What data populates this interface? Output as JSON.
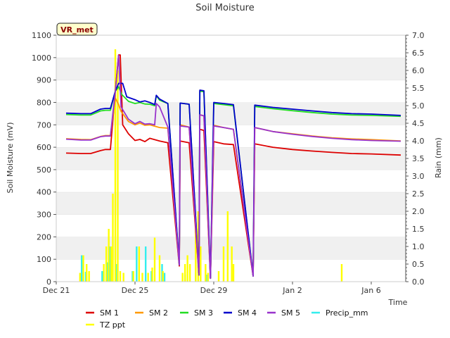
{
  "chart_data": {
    "type": "line",
    "title": "Soil Moisture",
    "xlabel": "Time",
    "ylabel": "Soil Moisture (mV)",
    "y2label": "Rain (mm)",
    "station_label": "VR_met",
    "xlim": [
      "2023-12-21",
      "2024-01-07 18:00"
    ],
    "x_ticks": [
      {
        "date": "2023-12-21",
        "label": "Dec 21"
      },
      {
        "date": "2023-12-25",
        "label": "Dec 25"
      },
      {
        "date": "2023-12-29",
        "label": "Dec 29"
      },
      {
        "date": "2024-01-02",
        "label": "Jan 2"
      },
      {
        "date": "2024-01-06",
        "label": "Jan 6"
      }
    ],
    "ylim": [
      0,
      1100
    ],
    "y_ticks": [
      0,
      100,
      200,
      300,
      400,
      500,
      600,
      700,
      800,
      900,
      1000,
      1100
    ],
    "y2lim": [
      0,
      7.0
    ],
    "y2_ticks": [
      "0.0",
      "0.5",
      "1.0",
      "1.5",
      "2.0",
      "2.5",
      "3.0",
      "3.5",
      "4.0",
      "4.5",
      "5.0",
      "5.5",
      "6.0",
      "6.5",
      "7.0"
    ],
    "grid": "horizontal bands",
    "legend_position": "bottom",
    "soil_series": [
      {
        "name": "SM 1",
        "color": "#dd0000",
        "points": [
          [
            "2023-12-21 12:00",
            574
          ],
          [
            "2023-12-22 06:00",
            572
          ],
          [
            "2023-12-22 18:00",
            572
          ],
          [
            "2023-12-23 06:00",
            585
          ],
          [
            "2023-12-23 12:00",
            590
          ],
          [
            "2023-12-23 18:00",
            590
          ],
          [
            "2023-12-24 00:00",
            850
          ],
          [
            "2023-12-24 04:00",
            1012
          ],
          [
            "2023-12-24 06:00",
            1012
          ],
          [
            "2023-12-24 09:00",
            700
          ],
          [
            "2023-12-24 16:00",
            660
          ],
          [
            "2023-12-25 00:00",
            630
          ],
          [
            "2023-12-25 06:00",
            635
          ],
          [
            "2023-12-25 12:00",
            625
          ],
          [
            "2023-12-25 18:00",
            640
          ],
          [
            "2023-12-26 06:00",
            628
          ],
          [
            "2023-12-26 16:00",
            620
          ],
          [
            "2023-12-27 06:00",
            70
          ],
          [
            "2023-12-27 07:00",
            628
          ],
          [
            "2023-12-27 18:00",
            620
          ],
          [
            "2023-12-28 06:00",
            30
          ],
          [
            "2023-12-28 07:00",
            680
          ],
          [
            "2023-12-28 12:00",
            675
          ],
          [
            "2023-12-28 20:00",
            15
          ],
          [
            "2023-12-29 00:00",
            625
          ],
          [
            "2023-12-29 12:00",
            615
          ],
          [
            "2023-12-30 00:00",
            612
          ],
          [
            "2023-12-31 00:00",
            25
          ],
          [
            "2023-12-31 02:00",
            615
          ],
          [
            "2024-01-01 00:00",
            600
          ],
          [
            "2024-01-02 00:00",
            590
          ],
          [
            "2024-01-03 00:00",
            583
          ],
          [
            "2024-01-04 00:00",
            577
          ],
          [
            "2024-01-05 00:00",
            572
          ],
          [
            "2024-01-06 00:00",
            570
          ],
          [
            "2024-01-07 12:00",
            565
          ]
        ]
      },
      {
        "name": "SM 2",
        "color": "#ff9900",
        "points": [
          [
            "2023-12-21 12:00",
            638
          ],
          [
            "2023-12-22 06:00",
            635
          ],
          [
            "2023-12-22 18:00",
            634
          ],
          [
            "2023-12-23 06:00",
            648
          ],
          [
            "2023-12-23 12:00",
            652
          ],
          [
            "2023-12-23 18:00",
            652
          ],
          [
            "2023-12-24 00:00",
            820
          ],
          [
            "2023-12-24 04:00",
            790
          ],
          [
            "2023-12-24 07:00",
            760
          ],
          [
            "2023-12-24 16:00",
            715
          ],
          [
            "2023-12-25 00:00",
            700
          ],
          [
            "2023-12-25 06:00",
            708
          ],
          [
            "2023-12-25 12:00",
            698
          ],
          [
            "2023-12-25 18:00",
            700
          ],
          [
            "2023-12-26 06:00",
            688
          ],
          [
            "2023-12-26 16:00",
            685
          ],
          [
            "2023-12-27 06:00",
            75
          ],
          [
            "2023-12-27 07:00",
            700
          ],
          [
            "2023-12-27 18:00",
            690
          ],
          [
            "2023-12-28 06:00",
            30
          ],
          [
            "2023-12-28 07:00",
            745
          ],
          [
            "2023-12-28 12:00",
            740
          ],
          [
            "2023-12-28 20:00",
            15
          ],
          [
            "2023-12-29 00:00",
            698
          ],
          [
            "2023-12-29 12:00",
            688
          ],
          [
            "2023-12-30 00:00",
            680
          ],
          [
            "2023-12-31 00:00",
            25
          ],
          [
            "2023-12-31 02:00",
            688
          ],
          [
            "2024-01-01 00:00",
            670
          ],
          [
            "2024-01-02 00:00",
            660
          ],
          [
            "2024-01-03 00:00",
            650
          ],
          [
            "2024-01-04 00:00",
            642
          ],
          [
            "2024-01-05 00:00",
            637
          ],
          [
            "2024-01-06 00:00",
            634
          ],
          [
            "2024-01-07 12:00",
            628
          ]
        ]
      },
      {
        "name": "SM 3",
        "color": "#22dd22",
        "points": [
          [
            "2023-12-21 12:00",
            746
          ],
          [
            "2023-12-22 06:00",
            744
          ],
          [
            "2023-12-22 18:00",
            744
          ],
          [
            "2023-12-23 06:00",
            762
          ],
          [
            "2023-12-23 12:00",
            765
          ],
          [
            "2023-12-23 18:00",
            765
          ],
          [
            "2023-12-24 00:00",
            850
          ],
          [
            "2023-12-24 04:00",
            870
          ],
          [
            "2023-12-24 08:00",
            835
          ],
          [
            "2023-12-24 16:00",
            805
          ],
          [
            "2023-12-25 00:00",
            795
          ],
          [
            "2023-12-25 06:00",
            800
          ],
          [
            "2023-12-25 12:00",
            793
          ],
          [
            "2023-12-25 18:00",
            792
          ],
          [
            "2023-12-26 00:00",
            785
          ],
          [
            "2023-12-26 02:00",
            830
          ],
          [
            "2023-12-26 06:00",
            810
          ],
          [
            "2023-12-26 16:00",
            795
          ],
          [
            "2023-12-27 06:00",
            75
          ],
          [
            "2023-12-27 07:00",
            797
          ],
          [
            "2023-12-27 18:00",
            792
          ],
          [
            "2023-12-28 06:00",
            30
          ],
          [
            "2023-12-28 07:00",
            850
          ],
          [
            "2023-12-28 12:00",
            848
          ],
          [
            "2023-12-28 20:00",
            15
          ],
          [
            "2023-12-29 00:00",
            795
          ],
          [
            "2023-12-29 12:00",
            790
          ],
          [
            "2023-12-30 00:00",
            785
          ],
          [
            "2023-12-31 00:00",
            25
          ],
          [
            "2023-12-31 02:00",
            782
          ],
          [
            "2024-01-01 00:00",
            772
          ],
          [
            "2024-01-02 00:00",
            763
          ],
          [
            "2024-01-03 00:00",
            755
          ],
          [
            "2024-01-04 00:00",
            748
          ],
          [
            "2024-01-05 00:00",
            744
          ],
          [
            "2024-01-06 00:00",
            742
          ],
          [
            "2024-01-07 12:00",
            738
          ]
        ]
      },
      {
        "name": "SM 4",
        "color": "#0000cc",
        "points": [
          [
            "2023-12-21 12:00",
            752
          ],
          [
            "2023-12-22 06:00",
            750
          ],
          [
            "2023-12-22 18:00",
            750
          ],
          [
            "2023-12-23 06:00",
            770
          ],
          [
            "2023-12-23 12:00",
            773
          ],
          [
            "2023-12-23 18:00",
            773
          ],
          [
            "2023-12-24 00:00",
            850
          ],
          [
            "2023-12-24 04:00",
            885
          ],
          [
            "2023-12-24 09:00",
            885
          ],
          [
            "2023-12-24 14:00",
            825
          ],
          [
            "2023-12-25 00:00",
            812
          ],
          [
            "2023-12-25 06:00",
            802
          ],
          [
            "2023-12-25 12:00",
            807
          ],
          [
            "2023-12-25 18:00",
            800
          ],
          [
            "2023-12-26 00:00",
            790
          ],
          [
            "2023-12-26 02:00",
            832
          ],
          [
            "2023-12-26 06:00",
            815
          ],
          [
            "2023-12-26 16:00",
            795
          ],
          [
            "2023-12-27 06:00",
            75
          ],
          [
            "2023-12-27 07:00",
            797
          ],
          [
            "2023-12-27 18:00",
            792
          ],
          [
            "2023-12-28 06:00",
            30
          ],
          [
            "2023-12-28 07:00",
            855
          ],
          [
            "2023-12-28 12:00",
            852
          ],
          [
            "2023-12-28 20:00",
            15
          ],
          [
            "2023-12-29 00:00",
            800
          ],
          [
            "2023-12-29 12:00",
            795
          ],
          [
            "2023-12-30 00:00",
            790
          ],
          [
            "2023-12-31 00:00",
            25
          ],
          [
            "2023-12-31 02:00",
            788
          ],
          [
            "2024-01-01 00:00",
            778
          ],
          [
            "2024-01-02 00:00",
            770
          ],
          [
            "2024-01-03 00:00",
            762
          ],
          [
            "2024-01-04 00:00",
            755
          ],
          [
            "2024-01-05 00:00",
            750
          ],
          [
            "2024-01-06 00:00",
            748
          ],
          [
            "2024-01-07 12:00",
            742
          ]
        ]
      },
      {
        "name": "SM 5",
        "color": "#9933cc",
        "points": [
          [
            "2023-12-21 12:00",
            636
          ],
          [
            "2023-12-22 06:00",
            632
          ],
          [
            "2023-12-22 18:00",
            632
          ],
          [
            "2023-12-23 06:00",
            647
          ],
          [
            "2023-12-23 12:00",
            650
          ],
          [
            "2023-12-23 18:00",
            650
          ],
          [
            "2023-12-24 00:00",
            850
          ],
          [
            "2023-12-24 04:00",
            1010
          ],
          [
            "2023-12-24 07:00",
            780
          ],
          [
            "2023-12-24 16:00",
            725
          ],
          [
            "2023-12-25 00:00",
            705
          ],
          [
            "2023-12-25 06:00",
            715
          ],
          [
            "2023-12-25 12:00",
            703
          ],
          [
            "2023-12-25 18:00",
            705
          ],
          [
            "2023-12-26 00:00",
            700
          ],
          [
            "2023-12-26 02:00",
            795
          ],
          [
            "2023-12-26 06:00",
            780
          ],
          [
            "2023-12-26 16:00",
            690
          ],
          [
            "2023-12-27 06:00",
            75
          ],
          [
            "2023-12-27 07:00",
            695
          ],
          [
            "2023-12-27 18:00",
            690
          ],
          [
            "2023-12-28 06:00",
            30
          ],
          [
            "2023-12-28 07:00",
            745
          ],
          [
            "2023-12-28 12:00",
            740
          ],
          [
            "2023-12-28 20:00",
            15
          ],
          [
            "2023-12-29 00:00",
            695
          ],
          [
            "2023-12-29 12:00",
            688
          ],
          [
            "2023-12-30 00:00",
            680
          ],
          [
            "2023-12-31 00:00",
            25
          ],
          [
            "2023-12-31 02:00",
            688
          ],
          [
            "2024-01-01 00:00",
            670
          ],
          [
            "2024-01-02 00:00",
            658
          ],
          [
            "2024-01-03 00:00",
            648
          ],
          [
            "2024-01-04 00:00",
            640
          ],
          [
            "2024-01-05 00:00",
            634
          ],
          [
            "2024-01-06 00:00",
            630
          ],
          [
            "2024-01-07 12:00",
            627
          ]
        ]
      }
    ],
    "rain_series": [
      {
        "name": "Precip_mm",
        "color": "#33eeee",
        "bars": [
          [
            "2023-12-22 07:00",
            0.75
          ],
          [
            "2023-12-22 12:00",
            0.28
          ],
          [
            "2023-12-23 08:00",
            0.3
          ],
          [
            "2023-12-23 14:00",
            0.55
          ],
          [
            "2023-12-23 17:00",
            1.0
          ],
          [
            "2023-12-24 01:00",
            0.5
          ],
          [
            "2023-12-24 21:00",
            0.3
          ],
          [
            "2023-12-25 02:00",
            1.0
          ],
          [
            "2023-12-25 13:00",
            1.0
          ],
          [
            "2023-12-25 20:00",
            0.3
          ],
          [
            "2023-12-26 09:00",
            0.5
          ],
          [
            "2023-12-26 12:00",
            0.25
          ],
          [
            "2023-12-27 13:00",
            0.2
          ],
          [
            "2023-12-28 02:00",
            0.25
          ],
          [
            "2023-12-28 15:00",
            0.2
          ]
        ]
      },
      {
        "name": "TZ ppt",
        "color": "#ffff00",
        "bars": [
          [
            "2023-12-22 05:00",
            0.25
          ],
          [
            "2023-12-22 09:00",
            0.75
          ],
          [
            "2023-12-22 13:00",
            0.5
          ],
          [
            "2023-12-22 16:00",
            0.3
          ],
          [
            "2023-12-23 10:00",
            0.5
          ],
          [
            "2023-12-23 13:00",
            1.0
          ],
          [
            "2023-12-23 16:00",
            1.5
          ],
          [
            "2023-12-23 19:00",
            1.0
          ],
          [
            "2023-12-23 21:00",
            2.5
          ],
          [
            "2023-12-24 00:00",
            6.6
          ],
          [
            "2023-12-24 03:00",
            6.0
          ],
          [
            "2023-12-24 06:00",
            0.3
          ],
          [
            "2023-12-24 10:00",
            0.25
          ],
          [
            "2023-12-24 22:00",
            0.3
          ],
          [
            "2023-12-25 05:00",
            1.0
          ],
          [
            "2023-12-25 09:00",
            0.25
          ],
          [
            "2023-12-25 16:00",
            0.25
          ],
          [
            "2023-12-25 21:00",
            0.4
          ],
          [
            "2023-12-26 00:00",
            1.25
          ],
          [
            "2023-12-26 06:00",
            0.75
          ],
          [
            "2023-12-26 10:00",
            0.3
          ],
          [
            "2023-12-27 10:00",
            0.25
          ],
          [
            "2023-12-27 13:00",
            0.5
          ],
          [
            "2023-12-27 16:00",
            0.75
          ],
          [
            "2023-12-27 19:00",
            0.5
          ],
          [
            "2023-12-28 02:00",
            1.75
          ],
          [
            "2023-12-28 05:00",
            2.0
          ],
          [
            "2023-12-28 08:00",
            1.0
          ],
          [
            "2023-12-28 14:00",
            0.5
          ],
          [
            "2023-12-28 17:00",
            0.25
          ],
          [
            "2023-12-29 06:00",
            0.3
          ],
          [
            "2023-12-29 12:00",
            1.0
          ],
          [
            "2023-12-29 17:00",
            2.0
          ],
          [
            "2023-12-29 22:00",
            1.0
          ],
          [
            "2023-12-30 00:00",
            0.5
          ],
          [
            "2024-01-04 12:00",
            0.5
          ]
        ]
      }
    ],
    "legend": [
      {
        "name": "SM 1",
        "color": "#dd0000"
      },
      {
        "name": "SM 2",
        "color": "#ff9900"
      },
      {
        "name": "SM 3",
        "color": "#22dd22"
      },
      {
        "name": "SM 4",
        "color": "#0000cc"
      },
      {
        "name": "SM 5",
        "color": "#9933cc"
      },
      {
        "name": "Precip_mm",
        "color": "#33eeee"
      },
      {
        "name": "TZ ppt",
        "color": "#ffff00"
      }
    ]
  }
}
